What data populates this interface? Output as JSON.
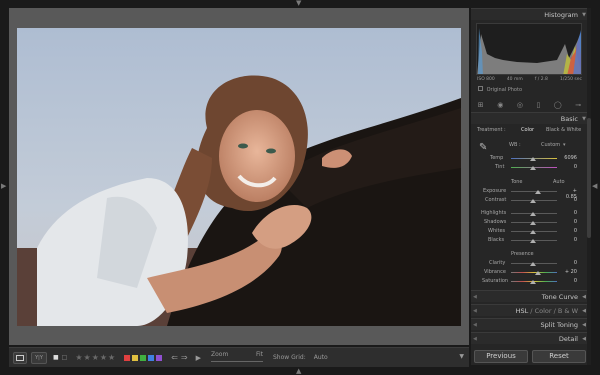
{
  "panels": {
    "histogram": "Histogram",
    "basic": "Basic",
    "tone_curve": "Tone Curve",
    "hsl": "HSL",
    "slash1": "/",
    "color": "Color",
    "slash2": "/",
    "bw": "B & W",
    "split_toning": "Split Toning",
    "detail": "Detail"
  },
  "histogram_info": {
    "iso": "ISO 800",
    "focal": "40 mm",
    "aperture": "f / 2.8",
    "shutter": "1/250 sec"
  },
  "original_photo": "Original Photo",
  "basic": {
    "treatment_label": "Treatment :",
    "color": "Color",
    "bw": "Black & White",
    "wb_label": "WB :",
    "wb_value": "Custom",
    "temp_label": "Temp",
    "temp_value": "6096",
    "tint_label": "Tint",
    "tint_value": "0",
    "tone_label": "Tone",
    "auto_label": "Auto",
    "exposure_label": "Exposure",
    "exposure_value": "+ 0.85",
    "contrast_label": "Contrast",
    "contrast_value": "0",
    "highlights_label": "Highlights",
    "highlights_value": "0",
    "shadows_label": "Shadows",
    "shadows_value": "0",
    "whites_label": "Whites",
    "whites_value": "0",
    "blacks_label": "Blacks",
    "blacks_value": "0",
    "presence_label": "Presence",
    "clarity_label": "Clarity",
    "clarity_value": "0",
    "vibrance_label": "Vibrance",
    "vibrance_value": "+ 20",
    "saturation_label": "Saturation",
    "saturation_value": "0"
  },
  "slider_levels": {
    "temp": 0.5,
    "tint": 0.5,
    "exposure": 0.6,
    "contrast": 0.5,
    "highlights": 0.5,
    "shadows": 0.5,
    "whites": 0.5,
    "blacks": 0.5,
    "clarity": 0.5,
    "vibrance": 0.6,
    "saturation": 0.5
  },
  "buttons": {
    "previous": "Previous",
    "reset": "Reset"
  },
  "toolbar": {
    "zoom_label": "Zoom",
    "fit_label": "Fit",
    "show_grid_label": "Show Grid:",
    "show_grid_value": "Auto",
    "stars": "★★★★★",
    "flag_colors": [
      "#e04040",
      "#e0c040",
      "#40b040",
      "#4080e0",
      "#9050d0"
    ]
  },
  "colors": {
    "accent": "#c8c8c8",
    "panel_bg": "#262626",
    "viewer_bg": "#595959"
  }
}
